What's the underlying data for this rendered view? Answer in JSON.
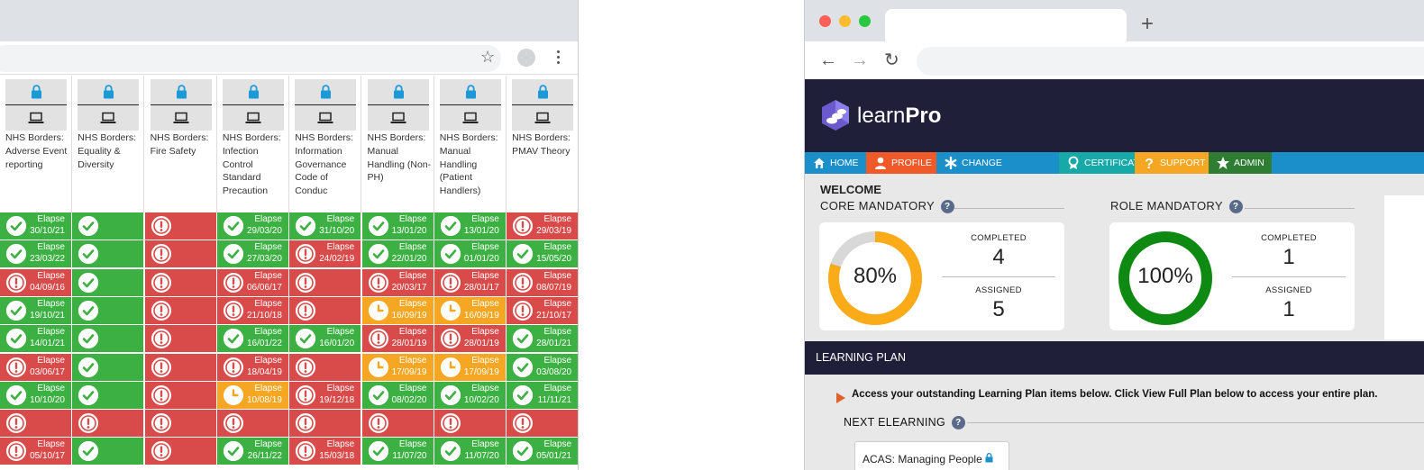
{
  "left_grid": {
    "columns": [
      {
        "title": "NHS Borders: Adverse Event reporting"
      },
      {
        "title": "NHS Borders: Equality & Diversity"
      },
      {
        "title": "NHS Borders: Fire Safety"
      },
      {
        "title": "NHS Borders: Infection Control Standard Precaution"
      },
      {
        "title": "NHS Borders: Information Governance Code of Conduc"
      },
      {
        "title": "NHS Borders: Manual Handling (Non-PH)"
      },
      {
        "title": "NHS Borders: Manual Handling (Patient Handlers)"
      },
      {
        "title": "NHS Borders: PMAV Theory"
      }
    ],
    "rows": [
      [
        {
          "s": "g",
          "l": "Elapse",
          "d": "30/10/21"
        },
        {
          "s": "g",
          "l": "",
          "d": ""
        },
        {
          "s": "r",
          "l": "",
          "d": ""
        },
        {
          "s": "g",
          "l": "Elapse",
          "d": "29/03/20"
        },
        {
          "s": "g",
          "l": "Elapse",
          "d": "31/10/20"
        },
        {
          "s": "g",
          "l": "Elapse",
          "d": "13/01/20"
        },
        {
          "s": "g",
          "l": "Elapse",
          "d": "13/01/20"
        },
        {
          "s": "r",
          "l": "Elapse",
          "d": "29/03/19"
        }
      ],
      [
        {
          "s": "g",
          "l": "Elapse",
          "d": "23/03/22"
        },
        {
          "s": "g",
          "l": "",
          "d": ""
        },
        {
          "s": "r",
          "l": "",
          "d": ""
        },
        {
          "s": "g",
          "l": "Elapse",
          "d": "27/03/20"
        },
        {
          "s": "r",
          "l": "Elapse",
          "d": "24/02/19"
        },
        {
          "s": "g",
          "l": "Elapse",
          "d": "22/01/20"
        },
        {
          "s": "g",
          "l": "Elapse",
          "d": "01/01/20"
        },
        {
          "s": "g",
          "l": "Elapse",
          "d": "15/05/20"
        }
      ],
      [
        {
          "s": "r",
          "l": "Elapse",
          "d": "04/09/16"
        },
        {
          "s": "g",
          "l": "",
          "d": ""
        },
        {
          "s": "r",
          "l": "",
          "d": ""
        },
        {
          "s": "r",
          "l": "Elapse",
          "d": "06/06/17"
        },
        {
          "s": "r",
          "l": "",
          "d": ""
        },
        {
          "s": "r",
          "l": "Elapse",
          "d": "20/03/17"
        },
        {
          "s": "r",
          "l": "Elapse",
          "d": "28/01/17"
        },
        {
          "s": "r",
          "l": "Elapse",
          "d": "08/07/19"
        }
      ],
      [
        {
          "s": "g",
          "l": "Elapse",
          "d": "19/10/21"
        },
        {
          "s": "g",
          "l": "",
          "d": ""
        },
        {
          "s": "r",
          "l": "",
          "d": ""
        },
        {
          "s": "r",
          "l": "Elapse",
          "d": "21/10/18"
        },
        {
          "s": "r",
          "l": "",
          "d": ""
        },
        {
          "s": "o",
          "l": "Elapse",
          "d": "16/09/19"
        },
        {
          "s": "o",
          "l": "Elapse",
          "d": "16/09/19"
        },
        {
          "s": "r",
          "l": "Elapse",
          "d": "21/10/17"
        }
      ],
      [
        {
          "s": "g",
          "l": "Elapse",
          "d": "14/01/21"
        },
        {
          "s": "g",
          "l": "",
          "d": ""
        },
        {
          "s": "r",
          "l": "",
          "d": ""
        },
        {
          "s": "g",
          "l": "Elapse",
          "d": "16/01/22"
        },
        {
          "s": "g",
          "l": "Elapse",
          "d": "16/01/20"
        },
        {
          "s": "r",
          "l": "Elapse",
          "d": "28/01/19"
        },
        {
          "s": "r",
          "l": "Elapse",
          "d": "28/01/19"
        },
        {
          "s": "g",
          "l": "Elapse",
          "d": "28/01/21"
        }
      ],
      [
        {
          "s": "r",
          "l": "Elapse",
          "d": "03/06/17"
        },
        {
          "s": "g",
          "l": "",
          "d": ""
        },
        {
          "s": "r",
          "l": "",
          "d": ""
        },
        {
          "s": "r",
          "l": "Elapse",
          "d": "18/04/19"
        },
        {
          "s": "r",
          "l": "",
          "d": ""
        },
        {
          "s": "o",
          "l": "Elapse",
          "d": "17/09/19"
        },
        {
          "s": "o",
          "l": "Elapse",
          "d": "17/09/19"
        },
        {
          "s": "g",
          "l": "Elapse",
          "d": "03/08/20"
        }
      ],
      [
        {
          "s": "g",
          "l": "Elapse",
          "d": "10/10/20"
        },
        {
          "s": "g",
          "l": "",
          "d": ""
        },
        {
          "s": "r",
          "l": "",
          "d": ""
        },
        {
          "s": "o",
          "l": "Elapse",
          "d": "10/08/19"
        },
        {
          "s": "r",
          "l": "Elapse",
          "d": "19/12/18"
        },
        {
          "s": "g",
          "l": "Elapse",
          "d": "08/02/20"
        },
        {
          "s": "g",
          "l": "Elapse",
          "d": "10/02/20"
        },
        {
          "s": "g",
          "l": "Elapse",
          "d": "11/11/21"
        }
      ],
      [
        {
          "s": "r",
          "l": "",
          "d": ""
        },
        {
          "s": "r",
          "l": "",
          "d": ""
        },
        {
          "s": "r",
          "l": "",
          "d": ""
        },
        {
          "s": "r",
          "l": "",
          "d": ""
        },
        {
          "s": "r",
          "l": "",
          "d": ""
        },
        {
          "s": "r",
          "l": "",
          "d": ""
        },
        {
          "s": "r",
          "l": "",
          "d": ""
        },
        {
          "s": "r",
          "l": "",
          "d": ""
        }
      ],
      [
        {
          "s": "r",
          "l": "Elapse",
          "d": "05/10/17"
        },
        {
          "s": "g",
          "l": "",
          "d": ""
        },
        {
          "s": "r",
          "l": "",
          "d": ""
        },
        {
          "s": "g",
          "l": "Elapse",
          "d": "26/11/22"
        },
        {
          "s": "r",
          "l": "Elapse",
          "d": "15/03/18"
        },
        {
          "s": "g",
          "l": "Elapse",
          "d": "11/07/20"
        },
        {
          "s": "g",
          "l": "Elapse",
          "d": "11/07/20"
        },
        {
          "s": "g",
          "l": "Elapse",
          "d": "05/01/21"
        }
      ]
    ]
  },
  "learnpro": {
    "brand_light": "learn",
    "brand_bold": "Pro",
    "menu": [
      {
        "label": "HOME",
        "color": "#1a8fc9",
        "icon": "home-icon"
      },
      {
        "label": "PROFILE",
        "color": "#f05a28",
        "icon": "user-icon"
      },
      {
        "label": "CHANGE PASSWORD",
        "color": "#1a8fc9",
        "icon": "asterisk-icon"
      },
      {
        "label": "CERTIFICATE",
        "color": "#17a8a8",
        "icon": "award-icon"
      },
      {
        "label": "SUPPORT",
        "color": "#f5a623",
        "icon": "question-icon"
      },
      {
        "label": "ADMIN",
        "color": "#2e7d32",
        "icon": "star-icon"
      }
    ],
    "welcome": "WELCOME",
    "core": {
      "title": "CORE MANDATORY",
      "percent": "80%",
      "completed_label": "COMPLETED",
      "completed": "4",
      "assigned_label": "ASSIGNED",
      "assigned": "5",
      "ring_color": "#fbab18",
      "progress": 0.8
    },
    "role": {
      "title": "ROLE MANDATORY",
      "percent": "100%",
      "completed_label": "COMPLETED",
      "completed": "1",
      "assigned_label": "ASSIGNED",
      "assigned": "1",
      "ring_color": "#0e8a12",
      "progress": 1.0
    },
    "plan_title": "LEARNING PLAN",
    "instruction": "Access your outstanding Learning Plan items below. Click View Full Plan below to access your entire plan.",
    "next_title": "NEXT ELEARNING",
    "next_course": "ACAS: Managing People"
  }
}
